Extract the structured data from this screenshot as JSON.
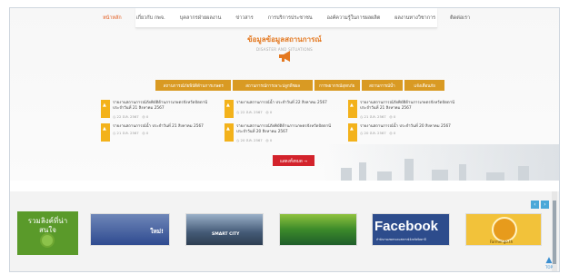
{
  "nav": {
    "items": [
      {
        "label": "หน้าหลัก",
        "active": true
      },
      {
        "label": "เกี่ยวกับ กพจ.",
        "active": false
      },
      {
        "label": "บุคลากรฝ่ายผลงาน",
        "active": false
      },
      {
        "label": "ข่าวสาร",
        "active": false
      },
      {
        "label": "การบริการประชาชน",
        "active": false
      },
      {
        "label": "องค์ความรู้ในการผลผลิต",
        "active": false
      },
      {
        "label": "ผลงานทางวิชาการ",
        "active": false
      },
      {
        "label": "ติดต่อเรา",
        "active": false
      }
    ]
  },
  "section": {
    "title": "ข้อมูลข้อมูลสถานการณ์",
    "subtitle": "DISASTER AND SITUATIONS",
    "icon": "megaphone-icon"
  },
  "tabs": [
    "สถานการณ์ภัยพิบัติด้านการเกษตร",
    "สถานการณ์การเพาะปลูกพืชผล",
    "การพยากรณ์อุทกภัย",
    "สถานการณ์น้ำ",
    "แจ้งเตือนภัย"
  ],
  "news": [
    {
      "title": "รายงานสถานการณ์ภัยพิบัติด้านการเกษตรจังหวัดปัตตานีประจำวันที่ 21 สิงหาคม 2567",
      "date": "22 ส.ค. 2567",
      "views": "0"
    },
    {
      "title": "รายงานสถานการณ์น้ำ ประจำวันที่ 22 สิงหาคม 2567",
      "date": "22 ส.ค. 2567",
      "views": "0"
    },
    {
      "title": "รายงานสถานการณ์ภัยพิบัติด้านการเกษตรจังหวัดปัตตานีประจำวันที่ 21 สิงหาคม 2567",
      "date": "21 ส.ค. 2567",
      "views": "0"
    },
    {
      "title": "รายงานสถานการณ์น้ำ ประจำวันที่ 21 สิงหาคม 2567",
      "date": "21 ส.ค. 2567",
      "views": "0"
    },
    {
      "title": "รายงานสถานการณ์ภัยพิบัติด้านการเกษตรจังหวัดปัตตานีประจำวันที่ 20 สิงหาคม 2567",
      "date": "20 ส.ค. 2567",
      "views": "0"
    },
    {
      "title": "รายงานสถานการณ์น้ำ ประจำวันที่ 20 สิงหาคม 2567",
      "date": "20 ส.ค. 2567",
      "views": "0"
    }
  ],
  "more_button": "แสดงทั้งหมด →",
  "links": {
    "label_line1": "รวมลิงค์ที่น่า",
    "label_line2": "สนใจ",
    "prev_icon": "chevron-left-icon",
    "next_icon": "chevron-right-icon",
    "banners": {
      "b1": "ใหม่!",
      "b2": "SMART CITY",
      "b4_title": "Facebook",
      "b4_sub": "สำนักงานเกษตรและสหกรณ์จังหวัดปัตตานี",
      "b5": "Farmer.go.th"
    }
  },
  "top_button": {
    "label": "TOP",
    "icon": "arrow-up-icon"
  },
  "colors": {
    "accent_orange": "#e4781f",
    "tab_gold": "#d99a23",
    "red_button": "#d3232c",
    "badge_yellow": "#f3b21b",
    "facebook_blue": "#2d4c8c",
    "links_green": "#5a9a2a"
  }
}
